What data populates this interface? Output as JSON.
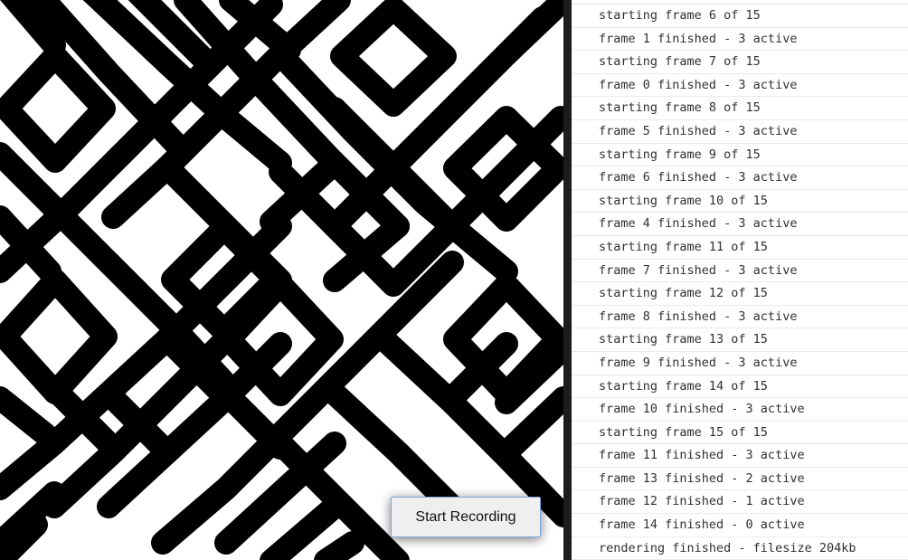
{
  "canvas": {
    "description_icon": "maze-pattern-canvas",
    "colors": {
      "ink": "#000000",
      "paper": "#ffffff"
    }
  },
  "controls": {
    "record_label": "Start Recording"
  },
  "console": {
    "lines": [
      "starting frame 6 of 15",
      "frame 1 finished - 3 active",
      "starting frame 7 of 15",
      "frame 0 finished - 3 active",
      "starting frame 8 of 15",
      "frame 5 finished - 3 active",
      "starting frame 9 of 15",
      "frame 6 finished - 3 active",
      "starting frame 10 of 15",
      "frame 4 finished - 3 active",
      "starting frame 11 of 15",
      "frame 7 finished - 3 active",
      "starting frame 12 of 15",
      "frame 8 finished - 3 active",
      "starting frame 13 of 15",
      "frame 9 finished - 3 active",
      "starting frame 14 of 15",
      "frame 10 finished - 3 active",
      "starting frame 15 of 15",
      "frame 11 finished - 3 active",
      "frame 13 finished - 2 active",
      "frame 12 finished - 1 active",
      "frame 14 finished - 0 active",
      "rendering finished - filesize 204kb"
    ]
  }
}
